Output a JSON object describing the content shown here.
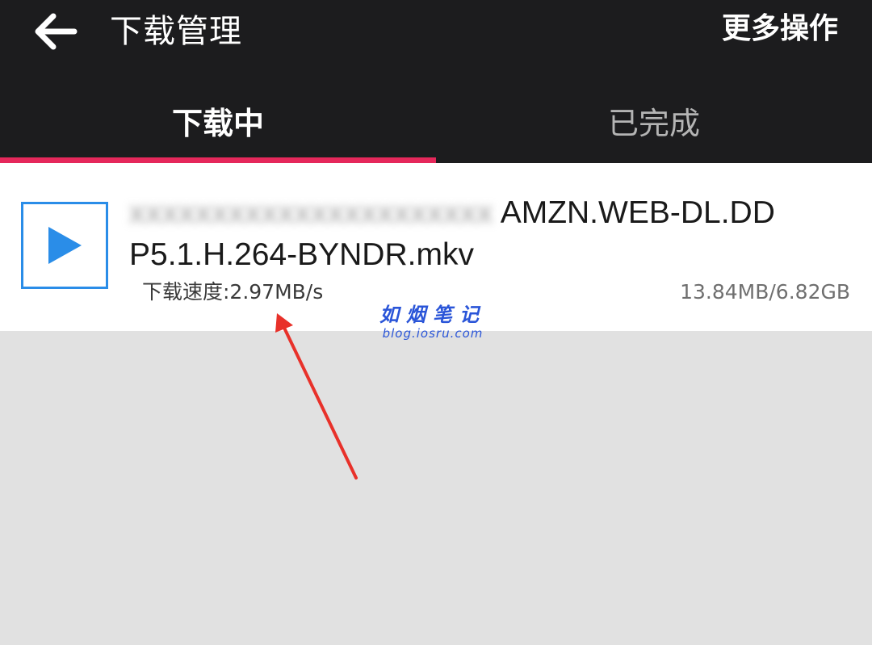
{
  "header": {
    "title": "下载管理",
    "more_label": "更多操作",
    "back_icon": "arrow-left-icon"
  },
  "tabs": [
    {
      "label": "下载中",
      "active": true
    },
    {
      "label": "已完成",
      "active": false
    }
  ],
  "accent_color": "#e5285b",
  "download": {
    "filename_visible": "AMZN.WEB-DL.DD",
    "filename_line2": "P5.1.H.264-BYNDR.mkv",
    "speed_text": "下载速度:2.97MB/s",
    "size_text": "13.84MB/6.82GB",
    "thumb_icon": "play-icon",
    "thumb_color": "#2a8de8"
  },
  "watermark": {
    "title": "如烟笔记",
    "url": "blog.iosru.com"
  }
}
